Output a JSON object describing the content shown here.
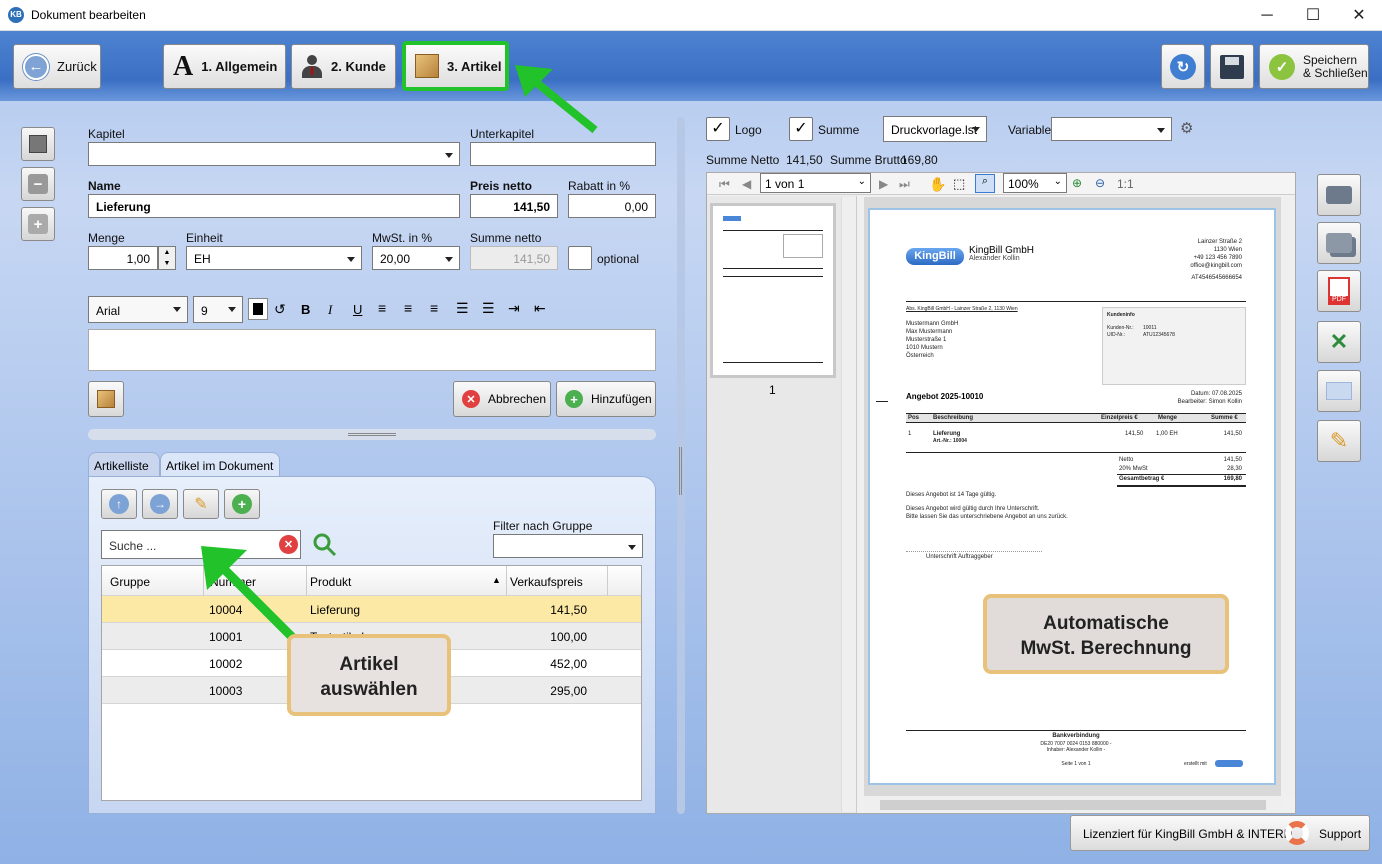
{
  "window": {
    "title": "Dokument bearbeiten",
    "app_icon": "KB"
  },
  "toolbar": {
    "back": "Zurück",
    "tab1": "1. Allgemein",
    "tab2": "2. Kunde",
    "tab3": "3. Artikel",
    "save_close_l1": "Speichern",
    "save_close_l2": "& Schließen"
  },
  "form": {
    "kapitel_label": "Kapitel",
    "unterkapitel_label": "Unterkapitel",
    "name_label": "Name",
    "name_value": "Lieferung",
    "preis_label": "Preis netto",
    "preis_value": "141,50",
    "rabatt_label": "Rabatt in %",
    "rabatt_value": "0,00",
    "menge_label": "Menge",
    "menge_value": "1,00",
    "einheit_label": "Einheit",
    "einheit_value": "EH",
    "mwst_label": "MwSt. in %",
    "mwst_value": "20,00",
    "summe_label": "Summe netto",
    "summe_value": "141,50",
    "optional_label": "optional",
    "font_value": "Arial",
    "size_value": "9",
    "cancel": "Abbrechen",
    "add": "Hinzufügen"
  },
  "list": {
    "tab_artikelliste": "Artikelliste",
    "tab_im_dokument": "Artikel im Dokument",
    "search_placeholder": "Suche ...",
    "filter_label": "Filter nach Gruppe",
    "columns": [
      "Gruppe",
      "Nummer",
      "Produkt",
      "Verkaufspreis"
    ],
    "rows": [
      {
        "nummer": "10004",
        "produkt": "Lieferung",
        "preis": "141,50"
      },
      {
        "nummer": "10001",
        "produkt": "Testartikel",
        "preis": "100,00"
      },
      {
        "nummer": "10002",
        "produkt": "",
        "preis": "452,00"
      },
      {
        "nummer": "10003",
        "produkt": "",
        "preis": "295,00"
      }
    ]
  },
  "preview": {
    "logo": "Logo",
    "summe": "Summe",
    "template": "Druckvorlage.lst",
    "variable": "Variable",
    "summe_netto": "Summe Netto",
    "summe_netto_val": "141,50",
    "summe_brutto": "Summe Brutto",
    "summe_brutto_val": "169,80",
    "page_nav": "1 von 1",
    "zoom": "100%",
    "ratio": "1:1",
    "thumb_page": "1"
  },
  "document": {
    "company": "KingBill GmbH",
    "person": "Alexander Kollin",
    "addr1": "Lainzer Straße 2",
    "addr2": "1130 Wien",
    "phone": "+49 123 456 7890",
    "email": "office@kingbill.com",
    "uid": "AT4546545666654",
    "sender_line": "Abs. KingBill GmbH - Lainzer Straße 2, 1130 Wien",
    "recipient": [
      "Mustermann GmbH",
      "Max Mustermann",
      "Musterstraße 1",
      "1010 Mustern",
      "Österreich"
    ],
    "kundeninfo": "Kundeninfo",
    "kundennr_label": "Kunden-Nr.:",
    "kundennr": "10011",
    "uid_label": "UID-Nr.:",
    "uid_val": "ATU12345678",
    "angebot": "Angebot 2025-10010",
    "datum": "Datum: 07.08.2025",
    "bearbeiter": "Bearbeiter: Simon Kollin",
    "cols": [
      "Pos",
      "Beschreibung",
      "Einzelpreis €",
      "Menge",
      "Summe €"
    ],
    "pos": "1",
    "item": "Lieferung",
    "artnr": "Art.-Nr.: 10004",
    "ep": "141,50",
    "menge": "1,00 EH",
    "sum": "141,50",
    "netto_l": "Netto",
    "netto": "141,50",
    "mwst_l": "20% MwSt",
    "mwst": "28,30",
    "gesamt_l": "Gesamtbetrag €",
    "gesamt": "169,80",
    "note1": "Dieses Angebot ist 14 Tage gültig.",
    "note2": "Dieses Angebot wird gültig durch Ihre Unterschrift.",
    "note3": "Bitte lassen Sie das unterschriebene Angebot an uns zurück.",
    "sign": "Unterschrift Auftraggeber",
    "bank": "Bankverbindung",
    "iban": "DE20 7007 0024 0153 880000 -",
    "inhaber": "Inhaber: Alexander Kollin -",
    "page": "Seite 1 von 1",
    "erstellt": "erstellt mit"
  },
  "callouts": {
    "mwst_l1": "Automatische",
    "mwst_l2": "MwSt. Berechnung",
    "artikel_l1": "Artikel",
    "artikel_l2": "auswählen"
  },
  "status": {
    "license": "Lizenziert für KingBill GmbH & INTERN",
    "support": "Support"
  }
}
